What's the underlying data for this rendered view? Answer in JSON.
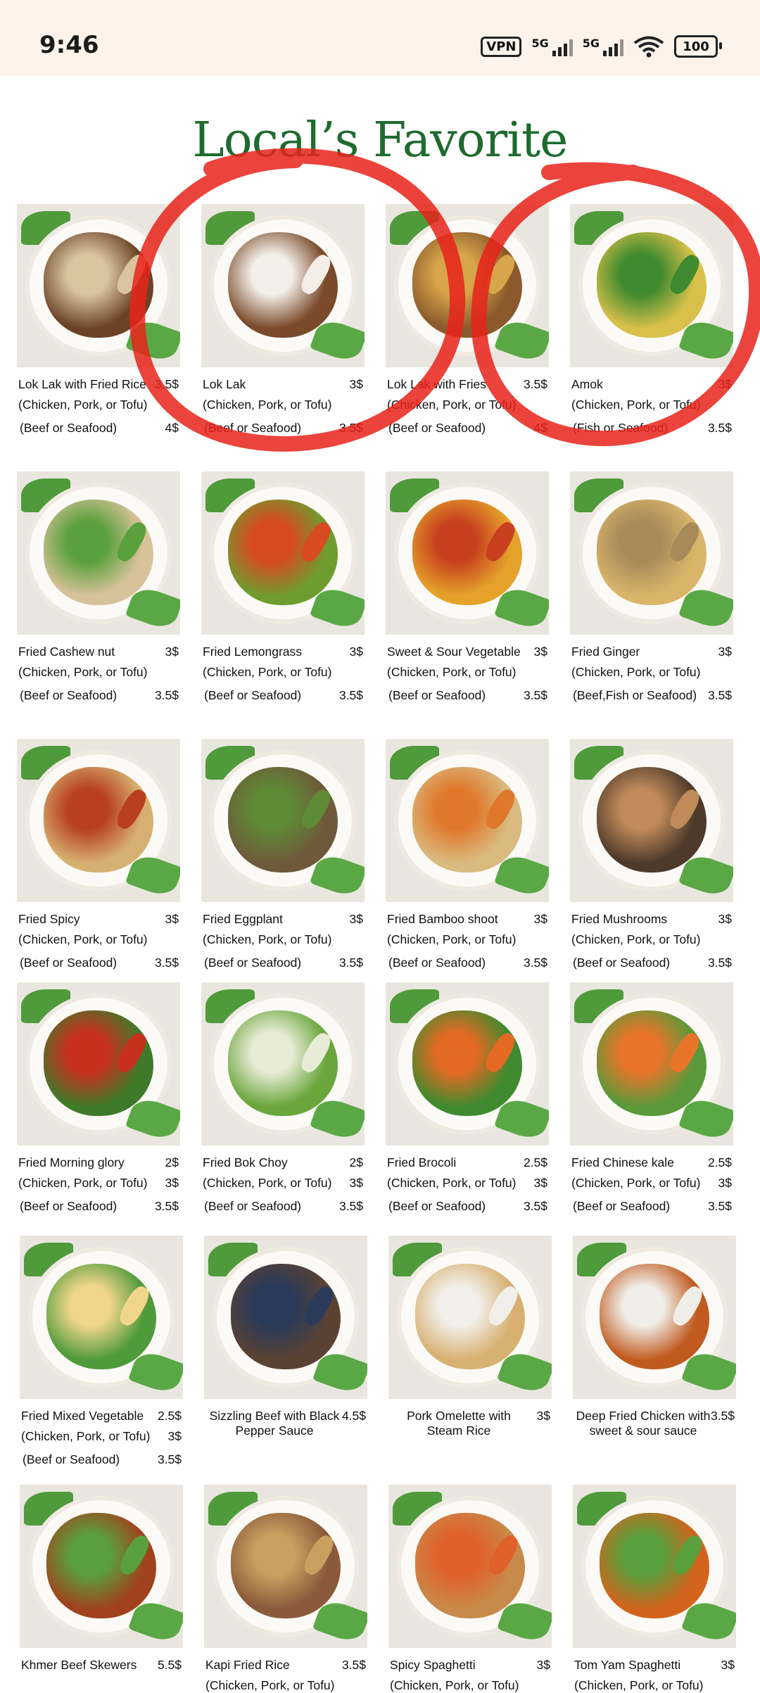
{
  "status_bar": {
    "time": "9:46",
    "vpn": "VPN",
    "network1": "5G",
    "network2": "5G",
    "battery": "100",
    "icons": [
      "vpn-icon",
      "signal-icon",
      "signal-icon",
      "wifi-icon",
      "battery-icon"
    ]
  },
  "menu": {
    "title": "Local’s Favorite",
    "items": [
      {
        "name": "Lok Lak with Fried Rice",
        "price": "3.5$",
        "opt1": "(Chicken, Pork, or Tofu)",
        "opt1_price": "",
        "opt2": "(Beef or Seafood)",
        "opt2_price": "4$",
        "colors": [
          "#6b4226",
          "#d9c4a0"
        ]
      },
      {
        "name": "Lok Lak",
        "price": "3$",
        "opt1": "(Chicken, Pork, or Tofu)",
        "opt1_price": "",
        "opt2": "(Beef or Seafood)",
        "opt2_price": "3.5$",
        "colors": [
          "#7a4a2a",
          "#f3efe8"
        ]
      },
      {
        "name": "Lok Lak with Fries",
        "price": "3.5$",
        "opt1": "(Chicken, Pork, or Tofu)",
        "opt1_price": "",
        "opt2": "(Beef or Seafood)",
        "opt2_price": "4$",
        "colors": [
          "#8a5a2c",
          "#d8a64a"
        ]
      },
      {
        "name": "Amok",
        "price": "3$",
        "opt1": "(Chicken, Pork, or Tofu)",
        "opt1_price": "",
        "opt2": "(Fish or Seafood)",
        "opt2_price": "3.5$",
        "colors": [
          "#d9c04a",
          "#3f8a2e"
        ]
      },
      {
        "name": "Fried Cashew nut",
        "price": "3$",
        "opt1": "(Chicken, Pork, or Tofu)",
        "opt1_price": "",
        "opt2": "(Beef or Seafood)",
        "opt2_price": "3.5$",
        "colors": [
          "#d8c29a",
          "#5aa03c"
        ]
      },
      {
        "name": "Fried Lemongrass",
        "price": "3$",
        "opt1": "(Chicken, Pork, or Tofu)",
        "opt1_price": "",
        "opt2": "(Beef or Seafood)",
        "opt2_price": "3.5$",
        "colors": [
          "#6f9c2e",
          "#d84a22"
        ]
      },
      {
        "name": "Sweet & Sour Vegetable",
        "price": "3$",
        "opt1": "(Chicken, Pork, or Tofu)",
        "opt1_price": "",
        "opt2": "(Beef or Seafood)",
        "opt2_price": "3.5$",
        "colors": [
          "#e4a22a",
          "#c8401e"
        ]
      },
      {
        "name": "Fried Ginger",
        "price": "3$",
        "opt1": "(Chicken, Pork, or Tofu)",
        "opt1_price": "",
        "opt2": "(Beef,Fish or Seafood)",
        "opt2_price": "3.5$",
        "colors": [
          "#d9b56a",
          "#a88a5a"
        ]
      },
      {
        "name": "Fried Spicy",
        "price": "3$",
        "opt1": "(Chicken, Pork, or Tofu)",
        "opt1_price": "",
        "opt2": "(Beef or Seafood)",
        "opt2_price": "3.5$",
        "colors": [
          "#d6b070",
          "#b8401e"
        ]
      },
      {
        "name": "Fried Eggplant",
        "price": "3$",
        "opt1": "(Chicken, Pork, or Tofu)",
        "opt1_price": "",
        "opt2": "(Beef or Seafood)",
        "opt2_price": "3.5$",
        "colors": [
          "#6e5a3a",
          "#5f8a36"
        ]
      },
      {
        "name": "Fried Bamboo shoot",
        "price": "3$",
        "opt1": "(Chicken, Pork, or Tofu)",
        "opt1_price": "",
        "opt2": "(Beef or Seafood)",
        "opt2_price": "3.5$",
        "colors": [
          "#d9bb80",
          "#e0782c"
        ]
      },
      {
        "name": "Fried Mushrooms",
        "price": "3$",
        "opt1": "(Chicken, Pork, or Tofu)",
        "opt1_price": "",
        "opt2": "(Beef or Seafood)",
        "opt2_price": "3.5$",
        "colors": [
          "#4e3a2a",
          "#c08a5a"
        ]
      },
      {
        "name": "Fried Morning glory",
        "price": "2$",
        "opt1": "(Chicken, Pork, or Tofu)",
        "opt1_price": "3$",
        "opt2": "(Beef or Seafood)",
        "opt2_price": "3.5$",
        "colors": [
          "#3f7a2a",
          "#c8301e"
        ]
      },
      {
        "name": "Fried Bok Choy",
        "price": "2$",
        "opt1": "(Chicken, Pork, or Tofu)",
        "opt1_price": "3$",
        "opt2": "(Beef or Seafood)",
        "opt2_price": "3.5$",
        "colors": [
          "#6aa63c",
          "#e8ecd6"
        ]
      },
      {
        "name": "Fried Brocoli",
        "price": "2.5$",
        "opt1": "(Chicken, Pork, or Tofu)",
        "opt1_price": "3$",
        "opt2": "(Beef or Seafood)",
        "opt2_price": "3.5$",
        "colors": [
          "#3f8a2e",
          "#e46a24"
        ]
      },
      {
        "name": "Fried Chinese kale",
        "price": "2.5$",
        "opt1": "(Chicken, Pork, or Tofu)",
        "opt1_price": "3$",
        "opt2": "(Beef or Seafood)",
        "opt2_price": "3.5$",
        "colors": [
          "#5a9a3a",
          "#e8742a"
        ]
      },
      {
        "name": "Fried Mixed Vegetable",
        "price": "2.5$",
        "opt1": "(Chicken, Pork, or Tofu)",
        "opt1_price": "3$",
        "opt2": "(Beef or Seafood)",
        "opt2_price": "3.5$",
        "colors": [
          "#4f9a3a",
          "#f0d68a"
        ]
      },
      {
        "name": "Sizzling Beef with Black Pepper Sauce",
        "price": "4.5$",
        "opt1": "",
        "opt1_price": "",
        "opt2": "",
        "opt2_price": "",
        "colors": [
          "#5a4232",
          "#2a3a5a"
        ],
        "centered": true
      },
      {
        "name": "Pork Omelette with Steam Rice",
        "price": "3$",
        "opt1": "",
        "opt1_price": "",
        "opt2": "",
        "opt2_price": "",
        "colors": [
          "#d8b070",
          "#f1efe9"
        ],
        "centered": true
      },
      {
        "name": "Deep Fried Chicken with sweet & sour sauce",
        "price": "3.5$",
        "opt1": "",
        "opt1_price": "",
        "opt2": "",
        "opt2_price": "",
        "colors": [
          "#c05a1e",
          "#f0eee8"
        ],
        "centered": true
      },
      {
        "name": "Khmer Beef Skewers",
        "price": "5.5$",
        "opt1": "",
        "opt1_price": "",
        "opt2": "",
        "opt2_price": "",
        "colors": [
          "#a0421e",
          "#5aa03c"
        ]
      },
      {
        "name": "Kapi Fried Rice",
        "price": "3.5$",
        "opt1": "(Chicken, Pork, or Tofu)",
        "opt1_price": "",
        "opt2": "",
        "opt2_price": "",
        "colors": [
          "#8a5a3a",
          "#c9a060"
        ]
      },
      {
        "name": "Spicy Spaghetti",
        "price": "3$",
        "opt1": "(Chicken, Pork, or Tofu)",
        "opt1_price": "",
        "opt2": "",
        "opt2_price": "",
        "colors": [
          "#c88a4a",
          "#e0602a"
        ]
      },
      {
        "name": "Tom Yam Spaghetti",
        "price": "3$",
        "opt1": "(Chicken, Pork, or Tofu)",
        "opt1_price": "",
        "opt2": "",
        "opt2_price": "",
        "colors": [
          "#d2641e",
          "#5aa03c"
        ]
      }
    ]
  },
  "annotations": {
    "circle_color": "#e8231a"
  }
}
